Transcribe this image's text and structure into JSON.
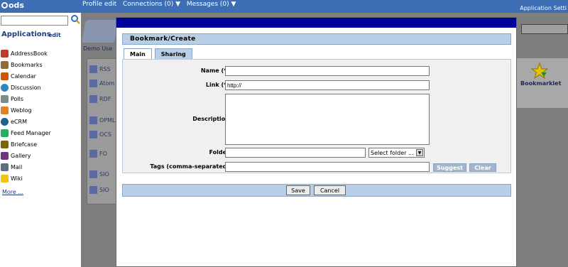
{
  "topbar": {
    "logo": "ods",
    "nav": [
      "Profile edit",
      "Connections (0) ▼",
      "Messages (0) ▼"
    ],
    "app_settings": "Application Setti"
  },
  "sidebar": {
    "title": "Applications",
    "edit": "edit",
    "items": [
      {
        "label": "AddressBook",
        "color": "#c0392b"
      },
      {
        "label": "Bookmarks",
        "color": "#8e6b3a"
      },
      {
        "label": "Calendar",
        "color": "#d35400"
      },
      {
        "label": "Discussion",
        "color": "#2e86c1"
      },
      {
        "label": "Polls",
        "color": "#7f8c8d"
      },
      {
        "label": "Weblog",
        "color": "#e67e22"
      },
      {
        "label": "eCRM",
        "color": "#1f618d"
      },
      {
        "label": "Feed Manager",
        "color": "#27ae60"
      },
      {
        "label": "Briefcase",
        "color": "#7d6608"
      },
      {
        "label": "Gallery",
        "color": "#6c3483"
      },
      {
        "label": "Mail",
        "color": "#5d6d7e"
      },
      {
        "label": "Wiki",
        "color": "#f1c40f"
      }
    ],
    "more": "More ..."
  },
  "background": {
    "demo": "Demo Use",
    "rows": [
      {
        "label": "RSS"
      },
      {
        "label": "Atom"
      },
      {
        "label": "RDF"
      },
      {
        "label": "OPML"
      },
      {
        "label": "OCS"
      },
      {
        "label": "FO"
      },
      {
        "label": "SIO"
      },
      {
        "label": "SIO"
      }
    ],
    "bookmarklet": "Bookmarklet"
  },
  "modal": {
    "header": "Bookmark/Create",
    "tabs": [
      "Main",
      "Sharing"
    ],
    "name_label": "Name (*)",
    "name_value": "",
    "link_label": "Link (*)",
    "link_value": "http://",
    "description_label": "Description",
    "description_value": "",
    "folder_label": "Folder",
    "folder_value": "",
    "folder_select": "Select folder ...",
    "tags_label": "Tags (comma-separated)",
    "tags_value": "",
    "suggest": "Suggest",
    "clear": "Clear",
    "save": "Save",
    "cancel": "Cancel"
  }
}
